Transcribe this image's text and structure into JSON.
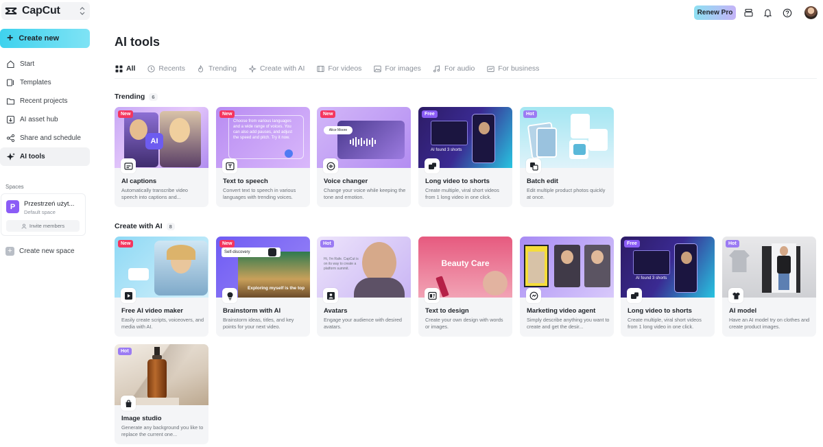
{
  "app": {
    "name": "CapCut"
  },
  "sidebar": {
    "create_new": "Create new",
    "items": [
      {
        "label": "Start",
        "icon": "home-icon"
      },
      {
        "label": "Templates",
        "icon": "templates-icon"
      },
      {
        "label": "Recent projects",
        "icon": "folder-icon"
      },
      {
        "label": "AI asset hub",
        "icon": "asset-hub-icon"
      },
      {
        "label": "Share and schedule",
        "icon": "share-icon"
      },
      {
        "label": "AI tools",
        "icon": "sparkle-icon",
        "active": true
      }
    ],
    "spaces_label": "Spaces",
    "space": {
      "initial": "P",
      "name": "Przestrzeń użyt...",
      "subtitle": "Default space",
      "invite": "Invite members"
    },
    "create_space": "Create new space"
  },
  "header": {
    "renew_label": "Renew Pro"
  },
  "main": {
    "title": "AI tools",
    "tabs": [
      {
        "label": "All",
        "active": true
      },
      {
        "label": "Recents"
      },
      {
        "label": "Trending"
      },
      {
        "label": "Create with AI"
      },
      {
        "label": "For videos"
      },
      {
        "label": "For images"
      },
      {
        "label": "For audio"
      },
      {
        "label": "For business"
      }
    ],
    "trending": {
      "title": "Trending",
      "count": "6",
      "cards": [
        {
          "badge": "New",
          "title": "AI captions",
          "desc": "Automatically transcribe video speech into captions and...",
          "thumb_text": "AI"
        },
        {
          "badge": "New",
          "title": "Text to speech",
          "desc": "Convert text to speech in various languages with trending voices.",
          "thumb_text": "Choose from various languages and a wide range of voices. You can also add pauses, and adjust the speed and pitch. Try it now."
        },
        {
          "badge": "New",
          "title": "Voice changer",
          "desc": "Change your voice while keeping the tone and emotion.",
          "thumb_text": "Alice Moore"
        },
        {
          "badge": "Free",
          "title": "Long video to shorts",
          "desc": "Create multiple, viral short videos from 1 long video in one click.",
          "thumb_text": "AI found 3 shorts"
        },
        {
          "badge": "Hot",
          "title": "Batch edit",
          "desc": "Edit multiple product photos quickly at once."
        }
      ]
    },
    "create_ai": {
      "title": "Create with AI",
      "count": "8",
      "cards": [
        {
          "badge": "New",
          "title": "Free AI video maker",
          "desc": "Easily create scripts, voiceovers, and media with AI."
        },
        {
          "badge": "New",
          "title": "Brainstorm with AI",
          "desc": "Brainstorm ideas, titles, and key points for your next video.",
          "thumb_text": "Self-discovery",
          "thumb_caption": "Exploring myself is the top"
        },
        {
          "badge": "Hot",
          "title": "Avatars",
          "desc": "Engage your audience with desired avatars.",
          "thumb_text": "Hi, I'm Rafe. CapCut is on its way to create a platform summit."
        },
        {
          "title": "Text to design",
          "desc": "Create your own design with words or images.",
          "thumb_text": "Beauty Care"
        },
        {
          "title": "Marketing video agent",
          "desc": "Simply describe anything you want to create and get the desir..."
        },
        {
          "badge": "Free",
          "title": "Long video to shorts",
          "desc": "Create multiple, viral short videos from 1 long video in one click.",
          "thumb_text": "AI found 3 shorts"
        },
        {
          "badge": "Hot",
          "title": "AI model",
          "desc": "Have an AI model try on clothes and create product images."
        },
        {
          "badge": "Hot",
          "title": "Image studio",
          "desc": "Generate any background you like to replace the current one..."
        }
      ]
    }
  }
}
